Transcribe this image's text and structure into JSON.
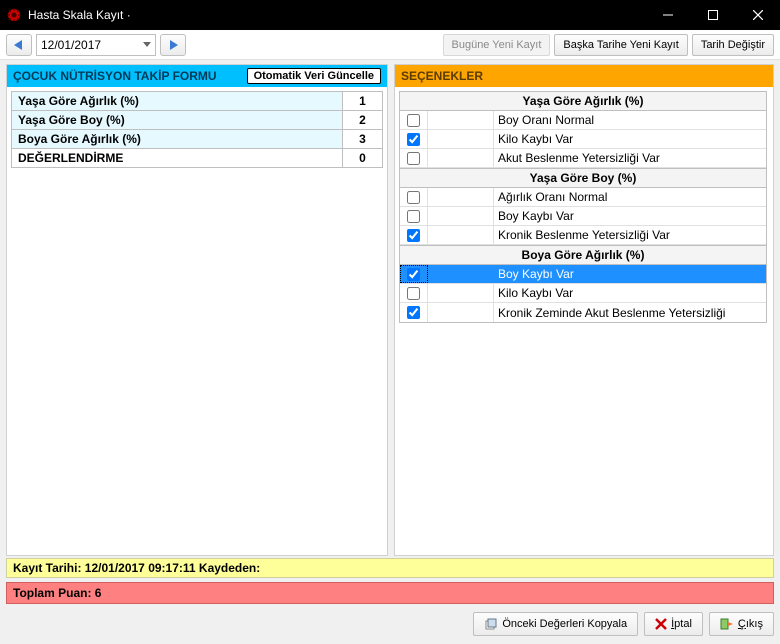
{
  "window": {
    "title": "Hasta Skala Kayıt ·"
  },
  "toolbar": {
    "date": "12/01/2017",
    "new_today": "Bugüne Yeni Kayıt",
    "new_other": "Başka Tarihe Yeni Kayıt",
    "change_date": "Tarih Değiştir"
  },
  "left": {
    "header": "ÇOCUK NÜTRİSYON TAKİP FORMU",
    "auto_update": "Otomatik Veri Güncelle",
    "rows": [
      {
        "label": "Yaşa Göre Ağırlık (%)",
        "value": "1",
        "hl": true
      },
      {
        "label": "Yaşa Göre Boy (%)",
        "value": "2",
        "hl": true
      },
      {
        "label": "Boya Göre Ağırlık (%)",
        "value": "3",
        "hl": true
      },
      {
        "label": "DEĞERLENDİRME",
        "value": "0",
        "hl": false
      }
    ]
  },
  "right": {
    "header": "SEÇENEKLER",
    "groups": [
      {
        "title": "Yaşa Göre Ağırlık (%)",
        "options": [
          {
            "label": "Boy Oranı Normal",
            "checked": false,
            "selected": false
          },
          {
            "label": "Kilo Kaybı Var",
            "checked": true,
            "selected": false
          },
          {
            "label": "Akut Beslenme Yetersizliği Var",
            "checked": false,
            "selected": false
          }
        ]
      },
      {
        "title": "Yaşa Göre Boy (%)",
        "options": [
          {
            "label": "Ağırlık Oranı Normal",
            "checked": false,
            "selected": false
          },
          {
            "label": "Boy Kaybı Var",
            "checked": false,
            "selected": false
          },
          {
            "label": "Kronik Beslenme Yetersizliği Var",
            "checked": true,
            "selected": false
          }
        ]
      },
      {
        "title": "Boya Göre Ağırlık (%)",
        "options": [
          {
            "label": "Boy Kaybı Var",
            "checked": true,
            "selected": true
          },
          {
            "label": "Kilo Kaybı Var",
            "checked": false,
            "selected": false
          },
          {
            "label": "Kronik Zeminde Akut Beslenme Yetersizliği",
            "checked": true,
            "selected": false
          }
        ]
      }
    ]
  },
  "status": {
    "record_line_prefix": "Kayıt Tarihi: ",
    "record_datetime": "12/01/2017 09:17:11",
    "recorded_by_label": "   Kaydeden:",
    "total_label": "Toplam Puan: ",
    "total_value": "6"
  },
  "footer": {
    "copy_prev": "Önceki Değerleri Kopyala",
    "cancel": "İptal",
    "exit": "Çıkış",
    "cancel_underline": "İ",
    "exit_underline": "Ç"
  }
}
